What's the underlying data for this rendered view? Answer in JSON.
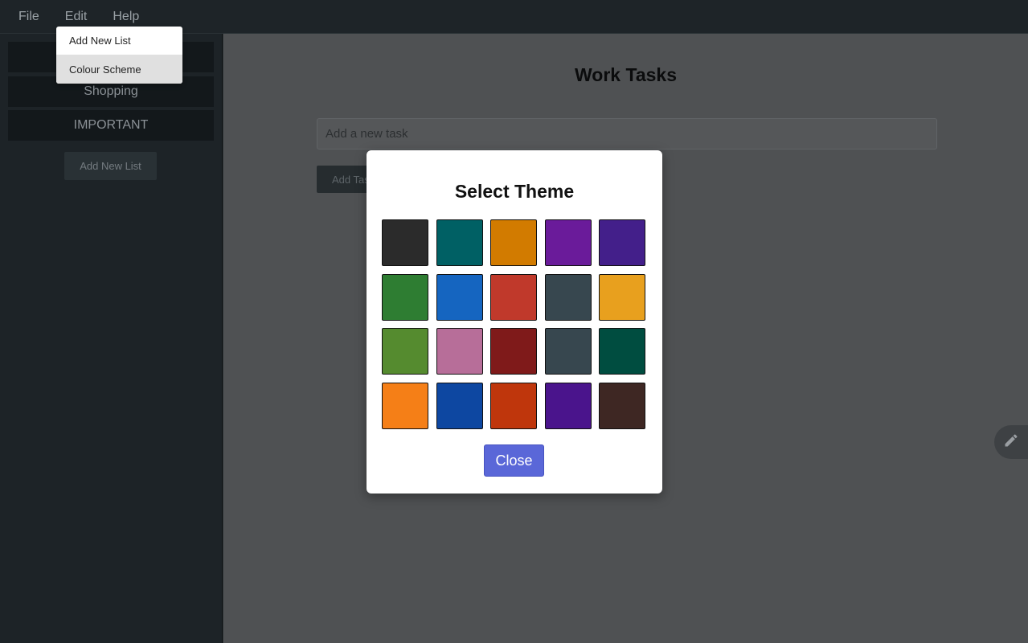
{
  "menubar": {
    "items": [
      {
        "label": "File"
      },
      {
        "label": "Edit"
      },
      {
        "label": "Help"
      }
    ]
  },
  "edit_menu": {
    "items": [
      {
        "label": "Add New List"
      },
      {
        "label": "Colour Scheme"
      }
    ]
  },
  "sidebar": {
    "lists": [
      {
        "label": ""
      },
      {
        "label": "Shopping"
      },
      {
        "label": "IMPORTANT"
      }
    ],
    "add_list_label": "Add New List"
  },
  "main": {
    "title": "Work Tasks",
    "task_placeholder": "Add a new task",
    "add_task_label": "Add Task",
    "edit_icon": "pencil-icon"
  },
  "theme_modal": {
    "title": "Select Theme",
    "close_label": "Close",
    "swatches": [
      "#2b2b2b",
      "#006064",
      "#d27b00",
      "#6a1b9a",
      "#431f8a",
      "#2e7d32",
      "#1565c0",
      "#c0392b",
      "#37474f",
      "#e8a01e",
      "#558b2f",
      "#b76e99",
      "#7f1a1a",
      "#37474f",
      "#004d40",
      "#f57f17",
      "#0d47a1",
      "#bf360c",
      "#4a148c",
      "#3e2723"
    ]
  }
}
